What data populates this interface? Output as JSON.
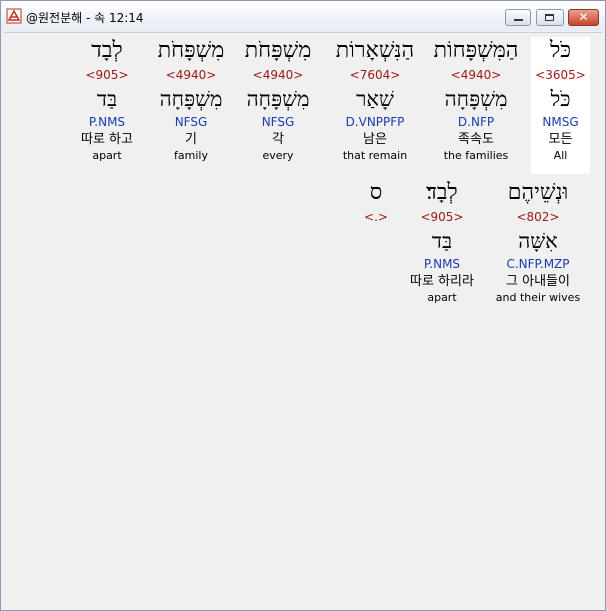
{
  "window": {
    "title": "@원전분해 - 속 12:14",
    "close_label": "✕"
  },
  "words": [
    {
      "heb": "כֹּל",
      "strong": "<3605>",
      "lemma": "כֹּל",
      "parse": "NMSG",
      "kor": "모든",
      "eng": "All"
    },
    {
      "heb": "הַמִּשְׁפָּחוֹת",
      "strong": "<4940>",
      "lemma": "מִשְׁפָּחָה",
      "parse": "D.NFP",
      "kor": "족속도",
      "eng": "the families"
    },
    {
      "heb": "הַנִּשְׁאָרוֹת",
      "strong": "<7604>",
      "lemma": "שָׁאַר",
      "parse": "D.VNPPFP",
      "kor": "남은",
      "eng": "that remain"
    },
    {
      "heb": "מִשְׁפָּחֹת",
      "strong": "<4940>",
      "lemma": "מִשְׁפָּחָה",
      "parse": "NFSG",
      "kor": "각",
      "eng": "every"
    },
    {
      "heb": "מִשְׁפָּחֹת",
      "strong": "<4940>",
      "lemma": "מִשְׁפָּחָה",
      "parse": "NFSG",
      "kor": "기",
      "eng": "family"
    },
    {
      "heb": "לְבָד",
      "strong": "<905>",
      "lemma": "בַּד",
      "parse": "P.NMS",
      "kor": "따로 하고",
      "eng": "apart"
    },
    {
      "heb": "וּנְשֵׁיהֶם",
      "strong": "<802>",
      "lemma": "אִשָּׁה",
      "parse": "C.NFP.MZP",
      "kor": "그 아내들이",
      "eng": "and their wives"
    },
    {
      "heb": "לְבָד׃",
      "strong": "<905>",
      "lemma": "בַּד",
      "parse": "P.NMS",
      "kor": "따로 하리라",
      "eng": "apart"
    },
    {
      "heb": "ס",
      "strong": "<.>",
      "lemma": "",
      "parse": "",
      "kor": "",
      "eng": ""
    }
  ]
}
